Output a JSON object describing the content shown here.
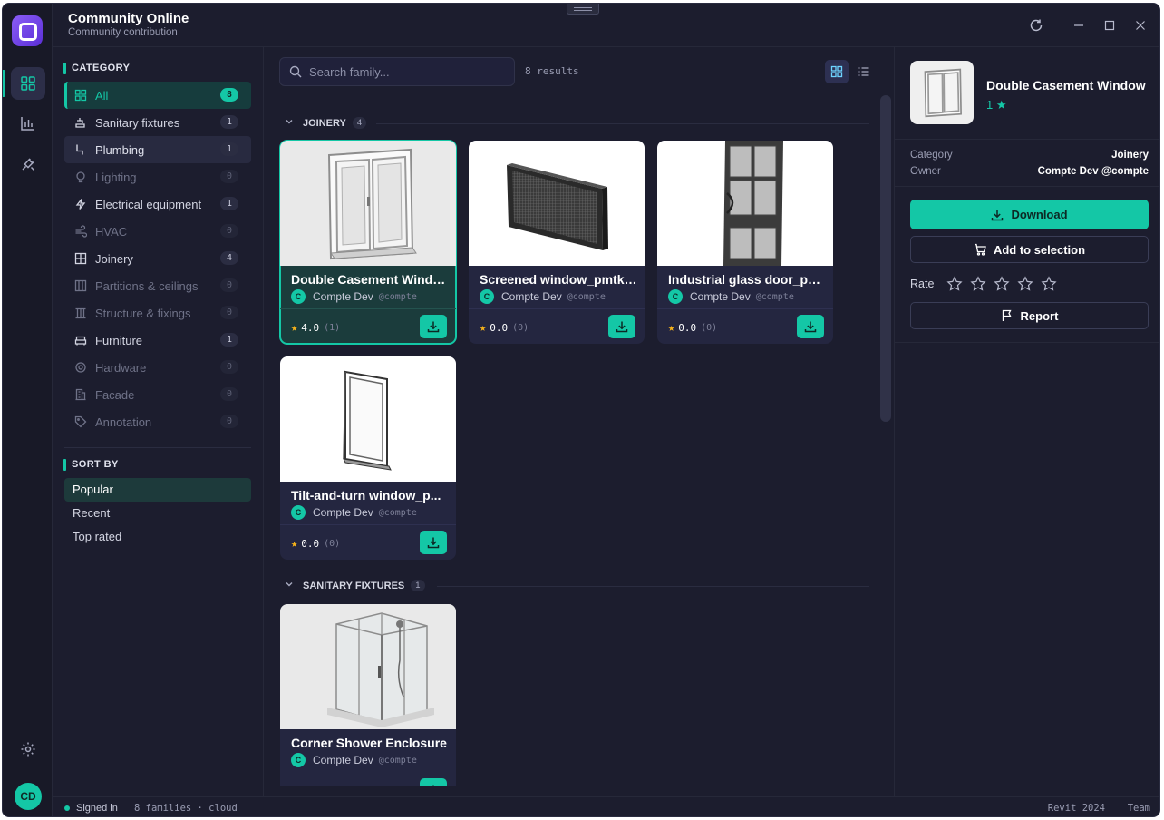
{
  "app": {
    "title": "Community Online",
    "subtitle": "Community contribution",
    "user_initials": "CD"
  },
  "colors": {
    "accent": "#14c7a6",
    "background": "#1c1d2e",
    "card": "#242640",
    "star": "#f5b21b",
    "logo": "#8a5cf6"
  },
  "rail": {
    "items": [
      {
        "icon": "grid-icon",
        "active": true
      },
      {
        "icon": "bar-chart-icon",
        "active": false
      },
      {
        "icon": "tools-icon",
        "active": false
      },
      {
        "icon": "settings-icon",
        "active": false
      }
    ]
  },
  "sidebar": {
    "category_heading": "CATEGORY",
    "categories": [
      {
        "label": "All",
        "count": "8",
        "icon": "grid-icon",
        "state": "active"
      },
      {
        "label": "Sanitary fixtures",
        "count": "1",
        "icon": "faucet-icon",
        "state": "normal"
      },
      {
        "label": "Plumbing",
        "count": "1",
        "icon": "pipe-icon",
        "state": "hover"
      },
      {
        "label": "Lighting",
        "count": "0",
        "icon": "bulb-icon",
        "state": "dim"
      },
      {
        "label": "Electrical equipment",
        "count": "1",
        "icon": "lightning-icon",
        "state": "normal"
      },
      {
        "label": "HVAC",
        "count": "0",
        "icon": "wind-icon",
        "state": "dim"
      },
      {
        "label": "Joinery",
        "count": "4",
        "icon": "window-icon",
        "state": "normal"
      },
      {
        "label": "Partitions & ceilings",
        "count": "0",
        "icon": "partition-icon",
        "state": "dim"
      },
      {
        "label": "Structure & fixings",
        "count": "0",
        "icon": "columns-icon",
        "state": "dim"
      },
      {
        "label": "Furniture",
        "count": "1",
        "icon": "sofa-icon",
        "state": "normal"
      },
      {
        "label": "Hardware",
        "count": "0",
        "icon": "gear-icon",
        "state": "dim"
      },
      {
        "label": "Facade",
        "count": "0",
        "icon": "building-icon",
        "state": "dim"
      },
      {
        "label": "Annotation",
        "count": "0",
        "icon": "tag-icon",
        "state": "dim"
      }
    ],
    "sort_heading": "SORT BY",
    "sort_options": [
      {
        "label": "Popular",
        "active": true
      },
      {
        "label": "Recent",
        "active": false
      },
      {
        "label": "Top rated",
        "active": false
      }
    ]
  },
  "toolbar": {
    "search_placeholder": "Search family...",
    "results": "8 results"
  },
  "groups": [
    {
      "label": "JOINERY",
      "count": "4"
    },
    {
      "label": "SANITARY FIXTURES",
      "count": "1"
    }
  ],
  "cards": [
    {
      "title": "Double Casement Window",
      "owner": "Compte Dev",
      "handle": "@compte",
      "owner_initial": "C",
      "rating": "4.0",
      "votes": "(1)",
      "thumb": "double-casement-window-icon"
    },
    {
      "title": "Screened window_pmtk_...",
      "owner": "Compte Dev",
      "handle": "@compte",
      "owner_initial": "C",
      "rating": "0.0",
      "votes": "(0)",
      "thumb": "screened-window-icon"
    },
    {
      "title": "Industrial glass door_pm...",
      "owner": "Compte Dev",
      "handle": "@compte",
      "owner_initial": "C",
      "rating": "0.0",
      "votes": "(0)",
      "thumb": "glass-door-icon"
    },
    {
      "title": "Tilt-and-turn window_p...",
      "owner": "Compte Dev",
      "handle": "@compte",
      "owner_initial": "C",
      "rating": "0.0",
      "votes": "(0)",
      "thumb": "tilt-turn-window-icon"
    },
    {
      "title": "Corner Shower Enclosure",
      "owner": "Compte Dev",
      "handle": "@compte",
      "owner_initial": "C",
      "rating": "",
      "votes": "",
      "thumb": "shower-enclosure-icon"
    }
  ],
  "detail": {
    "title": "Double Casement Window",
    "rating": "1 ★",
    "meta": [
      {
        "key": "Category",
        "value": "Joinery"
      },
      {
        "key": "Owner",
        "value": "Compte Dev @compte"
      }
    ],
    "download_label": "Download",
    "add_label": "Add to selection",
    "rate_label": "Rate",
    "report_label": "Report",
    "rate_value": 0
  },
  "status": {
    "signed_in": "Signed in",
    "info": "8 families · cloud",
    "revit": "Revit 2024",
    "plan": "Team"
  }
}
